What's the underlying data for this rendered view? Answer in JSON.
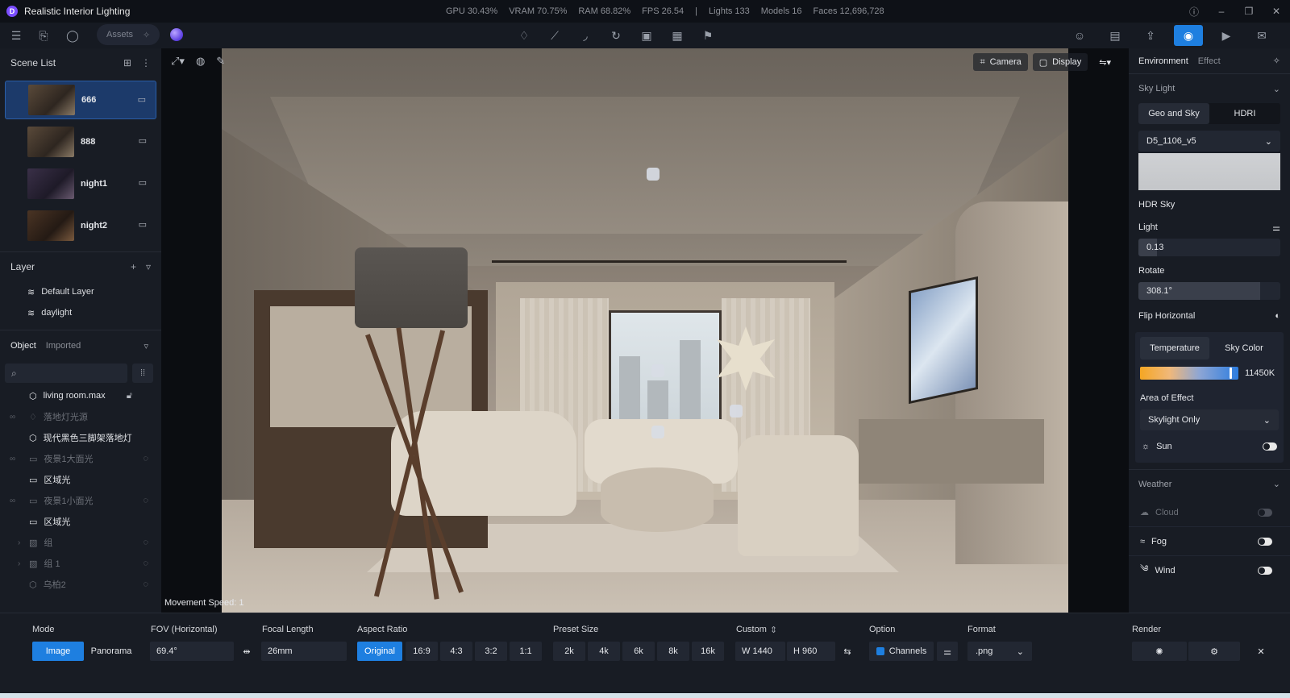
{
  "titlebar": {
    "app_title": "Realistic Interior Lighting",
    "stats": [
      "GPU 30.43%",
      "VRAM 70.75%",
      "RAM 68.82%",
      "FPS 26.54",
      "|",
      "Lights 133",
      "Models 16",
      "Faces 12,696,728"
    ]
  },
  "toolbar": {
    "assets_label": "Assets"
  },
  "scene_list": {
    "title": "Scene List",
    "items": [
      {
        "label": "666"
      },
      {
        "label": "888"
      },
      {
        "label": "night1"
      },
      {
        "label": "night2"
      }
    ]
  },
  "layer": {
    "title": "Layer",
    "items": [
      {
        "label": "Default Layer"
      },
      {
        "label": "daylight"
      }
    ]
  },
  "object": {
    "tab_object": "Object",
    "tab_imported": "Imported",
    "items": [
      {
        "label": "living room.max"
      },
      {
        "label": "落地灯光源"
      },
      {
        "label": "现代黑色三脚架落地灯"
      },
      {
        "label": "夜景1大面光"
      },
      {
        "label": "区域光"
      },
      {
        "label": "夜景1小面光"
      },
      {
        "label": "区域光"
      },
      {
        "label": "组"
      },
      {
        "label": "组 1"
      },
      {
        "label": "乌柏2"
      }
    ]
  },
  "viewport": {
    "camera_label": "Camera",
    "display_label": "Display",
    "movement_speed": "Movement Speed: 1"
  },
  "right_panel": {
    "tab_environment": "Environment",
    "tab_effect": "Effect",
    "sky_light_title": "Sky Light",
    "seg_geo": "Geo and Sky",
    "seg_hdri": "HDRI",
    "hdri_select": "D5_1106_v5",
    "hdr_sky_label": "HDR Sky",
    "light_label": "Light",
    "light_value": "0.13",
    "light_level": 0.13,
    "rotate_label": "Rotate",
    "rotate_value": "308.1°",
    "rotate_level": 0.856,
    "flip_label": "Flip Horizontal",
    "temp_tab": "Temperature",
    "sky_color_tab": "Sky Color",
    "temp_value": "11450K",
    "area_label": "Area of Effect",
    "area_select": "Skylight Only",
    "sun_label": "Sun",
    "weather_title": "Weather",
    "cloud_label": "Cloud",
    "fog_label": "Fog",
    "wind_label": "Wind"
  },
  "bottom": {
    "mode_label": "Mode",
    "mode_image": "Image",
    "mode_panorama": "Panorama",
    "fov_label": "FOV (Horizontal)",
    "fov_value": "69.4°",
    "focal_label": "Focal Length",
    "focal_value": "26mm",
    "aspect_label": "Aspect Ratio",
    "aspect_options": [
      "Original",
      "16:9",
      "4:3",
      "3:2",
      "1:1"
    ],
    "preset_label": "Preset Size",
    "preset_options": [
      "2k",
      "4k",
      "6k",
      "8k",
      "16k"
    ],
    "custom_label": "Custom",
    "custom_w": "W  1440",
    "custom_h": "H  960",
    "option_label": "Option",
    "channels_label": "Channels",
    "format_label": "Format",
    "format_value": ".png",
    "render_label": "Render"
  }
}
